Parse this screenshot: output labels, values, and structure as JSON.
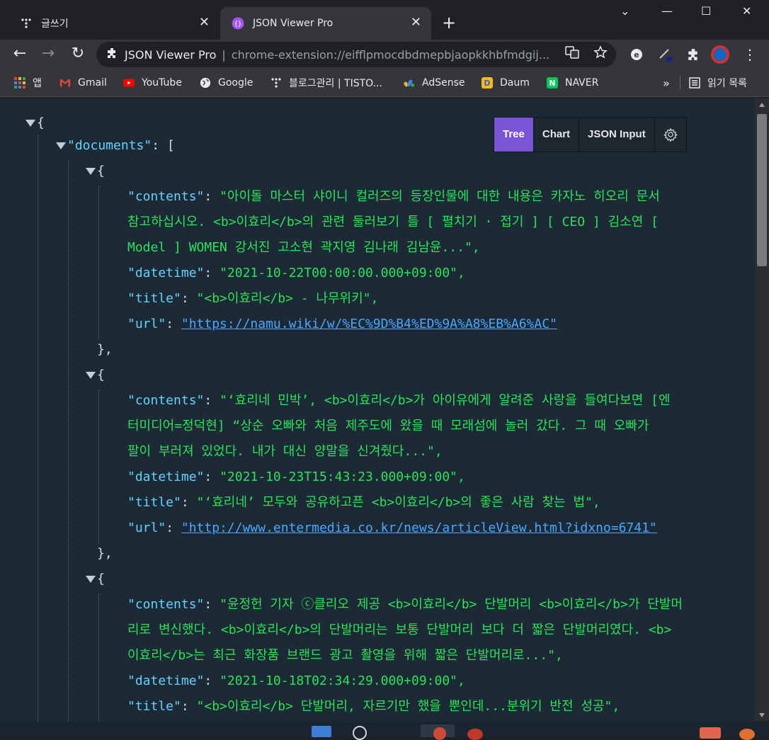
{
  "tabs": [
    {
      "title": "글쓰기",
      "close": "✕"
    },
    {
      "title": "JSON Viewer Pro",
      "close": "✕"
    }
  ],
  "newtab": "+",
  "window_controls": {
    "dropdown": "⌄",
    "minimize": "—",
    "maximize": "☐",
    "close": "✕"
  },
  "nav": {
    "back": "←",
    "forward": "→",
    "reload": "↻"
  },
  "omnibox": {
    "ext_name": "JSON Viewer Pro",
    "sep": "|",
    "url": "chrome-extension://eifflpmocdbdmepbjaopkkhbfmdgij..."
  },
  "bookmarks": [
    {
      "label": "앱"
    },
    {
      "label": "Gmail"
    },
    {
      "label": "YouTube"
    },
    {
      "label": "Google"
    },
    {
      "label": "블로그관리 | TISTO..."
    },
    {
      "label": "AdSense"
    },
    {
      "label": "Daum"
    },
    {
      "label": "NAVER"
    }
  ],
  "bookmarks_more": "»",
  "reading_list": "읽기 목록",
  "viewer": {
    "tree": "Tree",
    "chart": "Chart",
    "json_input": "JSON Input"
  },
  "json": {
    "open_root": "{",
    "documents_key": "\"documents\"",
    "colon": ": ",
    "open_array": "[",
    "open_obj": "{",
    "close_obj": "},",
    "items": [
      {
        "contents_key": "\"contents\"",
        "contents_lines": [
          "\"아이돌 마스터 샤이니 컬러즈의 등장인물에 대한 내용은 카자노 히오리 문서",
          "참고하십시오. <b>이효리</b>의 관련 둘러보기 틀 [ 펼치기 · 접기 ] [ CEO ] 김소연 [",
          "Model ] WOMEN 강서진 고소현 곽지영 김나래 김남윤...\","
        ],
        "datetime_key": "\"datetime\"",
        "datetime": "\"2021-10-22T00:00:00.000+09:00\",",
        "title_key": "\"title\"",
        "title": "\"<b>이효리</b> - 나무위키\",",
        "url_key": "\"url\"",
        "url": "\"https://namu.wiki/w/%EC%9D%B4%ED%9A%A8%EB%A6%AC\""
      },
      {
        "contents_key": "\"contents\"",
        "contents_lines": [
          "\"‘효리네 민박’, <b>이효리</b>가 아이유에게 알려준 사랑을 들여다보면 [엔",
          "터미디어=정덕현] “상순 오빠와 처음 제주도에 왔을 때 모래섬에 놀러 갔다. 그 때 오빠가",
          "팔이 부러져 있었다. 내가 대신 양말을 신겨줬다...\","
        ],
        "datetime_key": "\"datetime\"",
        "datetime": "\"2021-10-23T15:43:23.000+09:00\",",
        "title_key": "\"title\"",
        "title": "\"‘효리네’ 모두와 공유하고픈 <b>이효리</b>의 좋은 사람 찾는 법\",",
        "url_key": "\"url\"",
        "url": "\"http://www.entermedia.co.kr/news/articleView.html?idxno=6741\""
      },
      {
        "contents_key": "\"contents\"",
        "contents_lines": [
          "\"윤정헌 기자 ⓒ클리오 제공 <b>이효리</b> 단발머리 <b>이효리</b>가 단발머",
          "리로 변신했다. <b>이효리</b>의 단발머리는 보통 단발머리 보다 더 짧은 단발머리였다. <b>",
          "이효리</b>는 최근 화장품 브랜드 광고 촬영을 위해 짧은 단발머리로...\","
        ],
        "datetime_key": "\"datetime\"",
        "datetime": "\"2021-10-18T02:34:29.000+09:00\",",
        "title_key": "\"title\"",
        "title": "\"<b>이효리</b> 단발머리, 자르기만 했을 뿐인데...분위기 반전 성공\","
      }
    ]
  }
}
